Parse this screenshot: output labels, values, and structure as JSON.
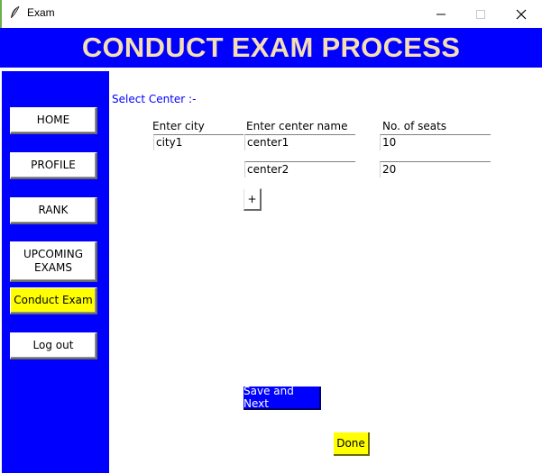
{
  "window": {
    "title": "Exam",
    "icon": "feather-icon"
  },
  "header": {
    "title": "CONDUCT EXAM PROCESS"
  },
  "sidebar": {
    "items": [
      {
        "label": "HOME"
      },
      {
        "label": "PROFILE"
      },
      {
        "label": "RANK"
      },
      {
        "label": "UPCOMING EXAMS"
      },
      {
        "label": "Conduct Exam",
        "active": true
      },
      {
        "label": "Log out"
      }
    ]
  },
  "main": {
    "section_label": "Select Center :-",
    "columns": {
      "city": "Enter city",
      "center": "Enter center name",
      "seats": "No. of seats"
    },
    "rows": [
      {
        "city": "city1",
        "center": "center1",
        "seats": "10"
      },
      {
        "center": "center2",
        "seats": "20"
      }
    ],
    "add_button": "+",
    "save_button": "Save and Next",
    "done_button": "Done"
  },
  "colors": {
    "header_bg": "#0000ff",
    "header_text": "#f5deb3",
    "sidebar_bg": "#0000ff",
    "active": "#ffff00"
  }
}
